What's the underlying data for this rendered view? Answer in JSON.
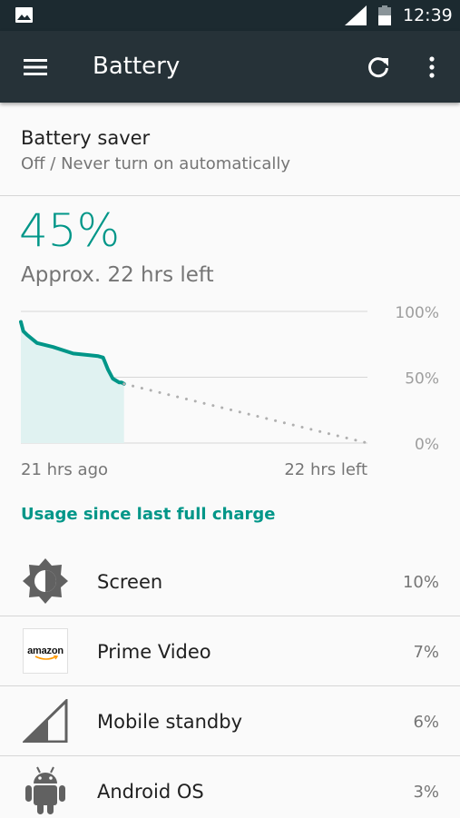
{
  "status_bar": {
    "time": "12:39",
    "icons": [
      "gallery-icon",
      "cell-signal-icon",
      "battery-icon"
    ]
  },
  "app_bar": {
    "title": "Battery",
    "icons": [
      "menu-icon",
      "refresh-icon",
      "more-vert-icon"
    ]
  },
  "battery_saver": {
    "title": "Battery saver",
    "status": "Off / Never turn on automatically"
  },
  "battery": {
    "level": "45%",
    "estimate": "Approx. 22 hrs left"
  },
  "chart_data": {
    "type": "line",
    "yticks": [
      "100%",
      "50%",
      "0%"
    ],
    "x_start_label": "21 hrs ago",
    "x_end_label": "22 hrs left",
    "ylim": [
      0,
      100
    ],
    "history": {
      "x": [
        -21,
        -20.7,
        -20.2,
        -19,
        -17,
        -14.5,
        -13,
        -11.4,
        -10.8,
        -10.6,
        -10.2,
        -9.6,
        -8.8,
        -8.5,
        -8.2
      ],
      "y": [
        92,
        85,
        82,
        76,
        73,
        68,
        67,
        66,
        65,
        62,
        56,
        49,
        46,
        46,
        45
      ]
    },
    "projection": {
      "x": [
        -8.2,
        22
      ],
      "y": [
        45,
        0
      ]
    },
    "colors": {
      "line": "#009688",
      "fill": "#e0f2f1",
      "projection": "#b0b0b0",
      "grid": "#d6d6d6"
    }
  },
  "usage": {
    "header": "Usage since last full charge",
    "items": [
      {
        "name": "Screen",
        "percent": "10%",
        "icon": "brightness-icon"
      },
      {
        "name": "Prime Video",
        "percent": "7%",
        "icon": "amazon-app-icon",
        "icon_text": "amazon"
      },
      {
        "name": "Mobile standby",
        "percent": "6%",
        "icon": "cell-signal-icon"
      },
      {
        "name": "Android OS",
        "percent": "3%",
        "icon": "android-icon"
      }
    ]
  },
  "colors": {
    "accent": "#009688",
    "app_bar": "#263238",
    "status_bar": "#1c2a30",
    "icon_gray": "#616161"
  }
}
